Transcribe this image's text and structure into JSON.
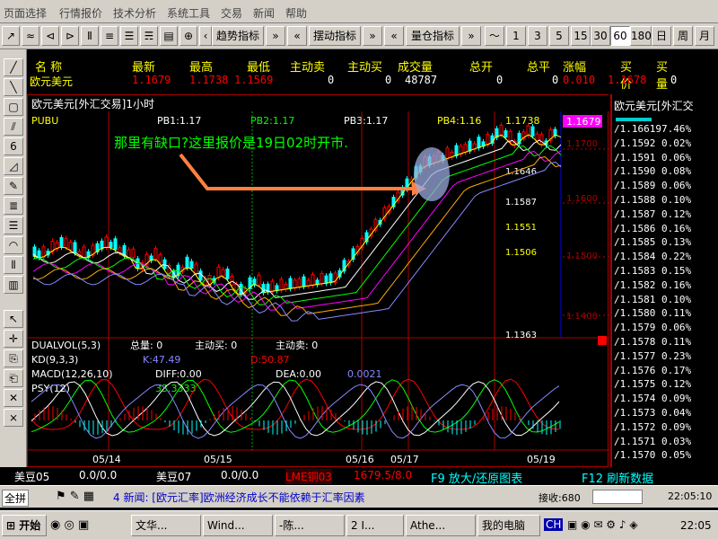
{
  "menu": [
    "页面选择",
    "行情报价",
    "技术分析",
    "系统工具",
    "交易",
    "新闻",
    "帮助"
  ],
  "toolbar": {
    "trend_label": "趋势指标",
    "swing_label": "摆动指标",
    "volume_label": "量仓指标",
    "periods": [
      "1",
      "3",
      "5",
      "15",
      "30",
      "60",
      "180",
      "日",
      "周",
      "月"
    ],
    "selected_period": "60"
  },
  "quote": {
    "headers": [
      "名 称",
      "最新",
      "最高",
      "最低",
      "主动卖",
      "主动买",
      "成交量",
      "总开",
      "总平",
      "涨幅",
      "买价",
      "买量"
    ],
    "values": {
      "name": "欧元美元",
      "last": "1.1679",
      "high": "1.1738",
      "low": "1.1569",
      "active_sell": "0",
      "active_buy": "0",
      "volume": "48787",
      "total_open": "0",
      "total_close": "0",
      "change": "0.010",
      "bid": "1.1678",
      "bid_vol": "0"
    }
  },
  "chart": {
    "title": "欧元美元[外汇交易]1小时",
    "indicator": "PUBU",
    "pb": [
      "PB1:1.17",
      "PB2:1.17",
      "PB3:1.17",
      "PB4:1.16"
    ],
    "current_price": "1.1679",
    "top_price": "1.1738",
    "annotation": "那里有缺口?这里报价是19日02时开市.",
    "price_labels": [
      "1.1700",
      "1.1600",
      "1.1500",
      "1.1400",
      "1.1551",
      "1.1506",
      "1.1363",
      "1.1587",
      "1.1646"
    ],
    "dates": [
      "05/14",
      "05/15",
      "05/16",
      "05/17",
      "05/19"
    ],
    "lower": {
      "dualvol": "DUALVOL(5,3)",
      "total_vol": "总量: 0",
      "active_buy": "主动买: 0",
      "active_sell": "主动卖: 0",
      "kd": "KD(9,3,3)",
      "k": "K:47.49",
      "d": "D:50.87",
      "macd": "MACD(12,26,10)",
      "diff": "DIFF:0.00",
      "dea": "DEA:0.00",
      "macd_val": "0.0021",
      "psy": "PSY(12)",
      "psy_val": "33.3333"
    }
  },
  "right_panel": {
    "title": "欧元美元[外汇交",
    "rows": [
      "/1.166197.46%",
      "/1.1592 0.02%",
      "/1.1591 0.06%",
      "/1.1590 0.08%",
      "/1.1589 0.06%",
      "/1.1588 0.10%",
      "/1.1587 0.12%",
      "/1.1586 0.16%",
      "/1.1585 0.13%",
      "/1.1584 0.22%",
      "/1.1583 0.15%",
      "/1.1582 0.16%",
      "/1.1581 0.10%",
      "/1.1580 0.11%",
      "/1.1579 0.06%",
      "/1.1578 0.11%",
      "/1.1577 0.23%",
      "/1.1576 0.17%",
      "/1.1575 0.12%",
      "/1.1574 0.09%",
      "/1.1573 0.04%",
      "/1.1572 0.09%",
      "/1.1571 0.03%",
      "/1.1570 0.05%"
    ]
  },
  "status": {
    "s1": "美豆05",
    "s1v": "0.0/0.0",
    "s2": "美豆07",
    "s2v": "0.0/0.0",
    "s3": "LME铜03",
    "s3v": "1679.5/8.0",
    "f9": "F9 放大/还原图表",
    "f12": "F12 刷新数据"
  },
  "status2": {
    "full": "全拼",
    "news": "4 新闻: [欧元汇率]欧洲经济成长不能依赖于汇率因素",
    "recv": "接收:680",
    "time": "22:05:10"
  },
  "taskbar": {
    "start": "开始",
    "items": [
      "文华...",
      "Wind...",
      "-陈...",
      "2 I...",
      "Athe...",
      "我的电脑"
    ],
    "clock": "22:05"
  },
  "colors": {
    "red": "#ff0000",
    "yellow": "#ffff00",
    "cyan": "#00ffff",
    "green": "#00ff00"
  }
}
